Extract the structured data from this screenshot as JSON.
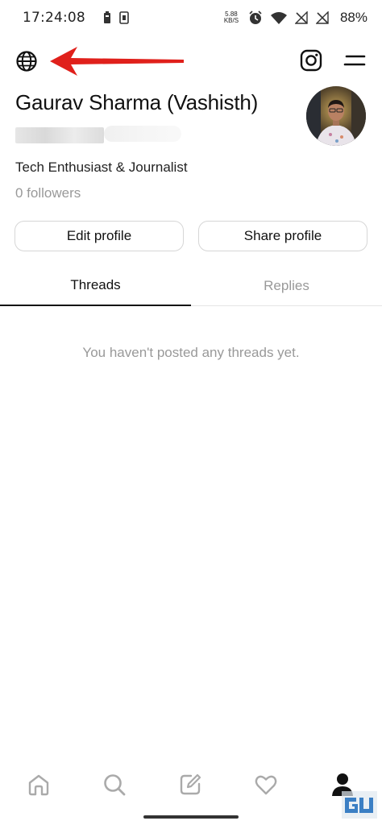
{
  "status_bar": {
    "time": "17:24:08",
    "net_speed_value": "5.88",
    "net_speed_unit": "KB/S",
    "battery_percent": "88%"
  },
  "topbar": {
    "globe_icon": "globe-icon",
    "instagram_icon": "instagram-icon",
    "menu_icon": "menu-icon",
    "annotation_color": "#e0201b"
  },
  "profile": {
    "name": "Gaurav Sharma (Vashisth)",
    "bio": "Tech Enthusiast & Journalist",
    "followers": "0 followers"
  },
  "actions": {
    "edit_profile": "Edit profile",
    "share_profile": "Share profile"
  },
  "tabs": [
    {
      "label": "Threads",
      "active": true
    },
    {
      "label": "Replies",
      "active": false
    }
  ],
  "feed": {
    "empty_message": "You haven't posted any threads yet."
  },
  "bottom_nav": [
    {
      "icon": "home-icon"
    },
    {
      "icon": "search-icon"
    },
    {
      "icon": "compose-icon"
    },
    {
      "icon": "heart-icon"
    },
    {
      "icon": "profile-icon",
      "active": true
    }
  ]
}
